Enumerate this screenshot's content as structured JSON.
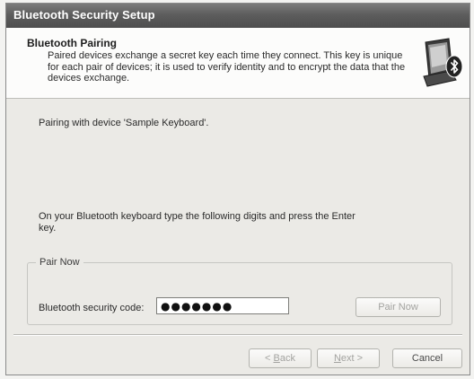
{
  "window": {
    "title": "Bluetooth Security Setup"
  },
  "header": {
    "title": "Bluetooth Pairing",
    "description": "Paired devices exchange a secret key each time they connect. This key is unique for each pair of devices; it is used to verify identity and to encrypt the data that the devices exchange.",
    "icon": "bluetooth-pc-icon"
  },
  "content": {
    "pairing_text": "Pairing with device 'Sample Keyboard'.",
    "instruction_text": "On your Bluetooth keyboard type the following digits and press the Enter key.",
    "group": {
      "label": "Pair Now",
      "code_label": "Bluetooth security code:",
      "code_value": "●●●●●●●",
      "pair_button": "Pair Now"
    }
  },
  "footer": {
    "back_label_accel": "B",
    "back_label_rest": "ack",
    "back_prefix": "< ",
    "next_label_accel": "N",
    "next_label_rest": "ext",
    "next_suffix": " >",
    "cancel_label": "Cancel"
  },
  "colors": {
    "titlebar": "#5d5d5d",
    "header_bg": "#fcfcfb",
    "body_bg": "#ebeae6",
    "disabled_text": "#a3a3a0"
  }
}
